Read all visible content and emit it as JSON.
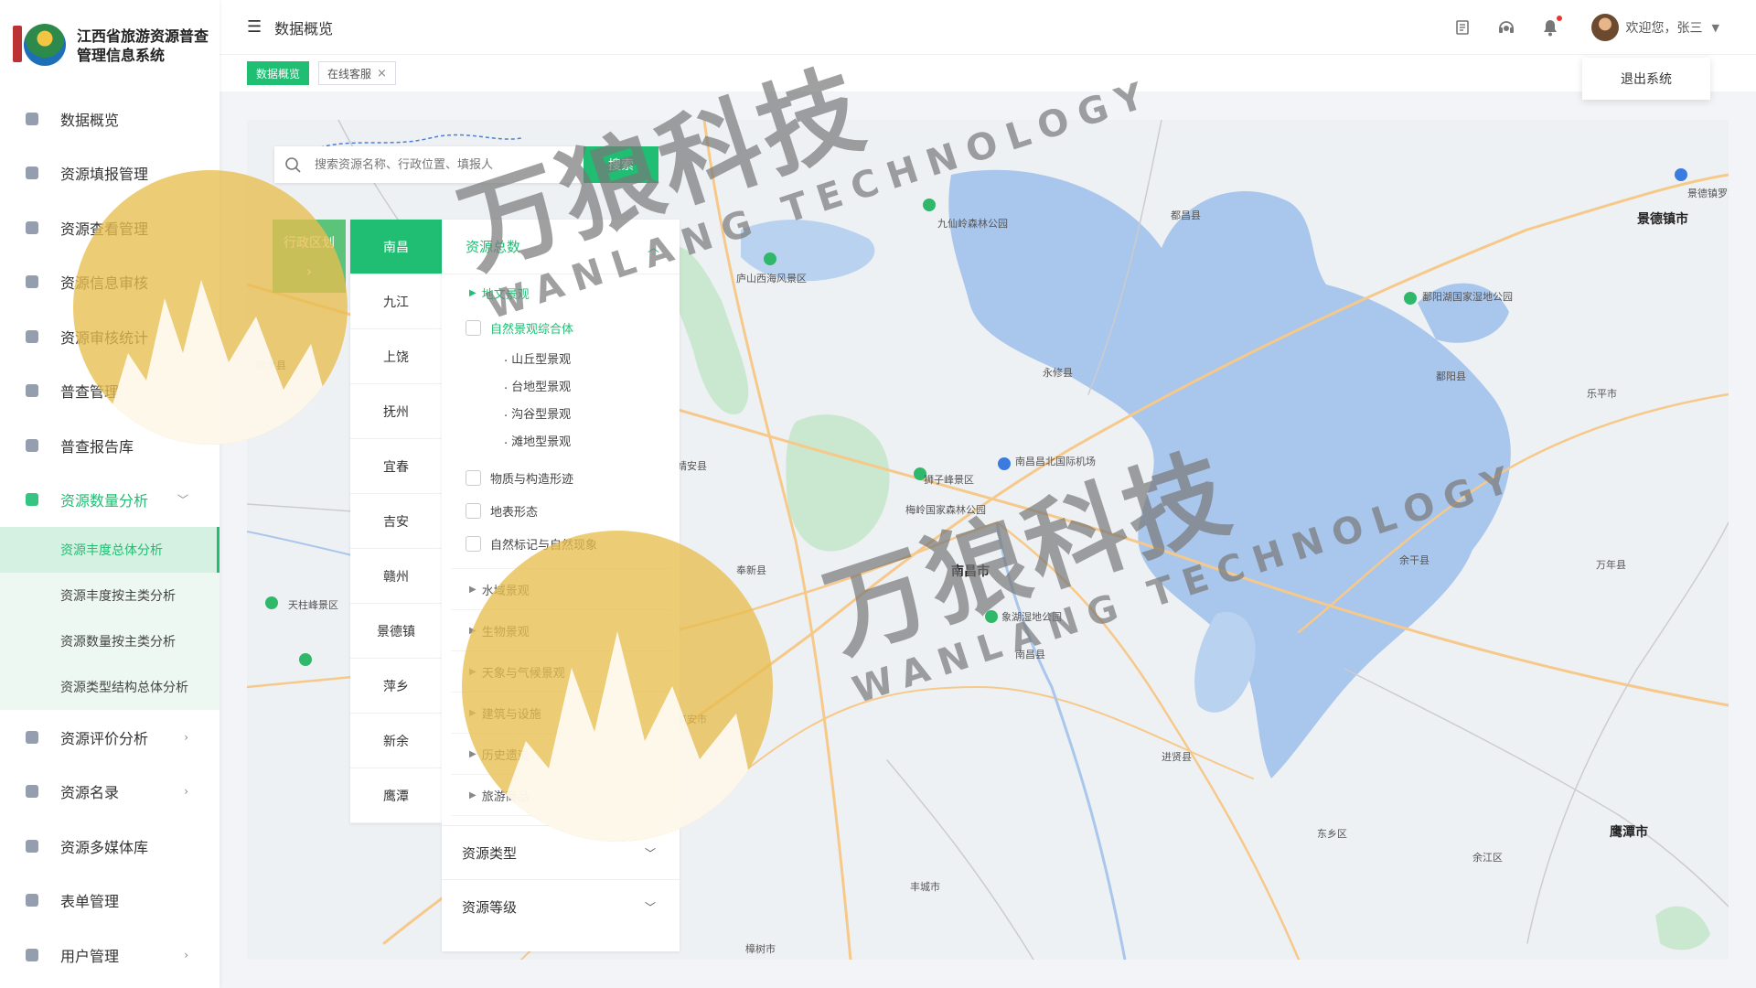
{
  "app": {
    "title_line1": "江西省旅游资源普查",
    "title_line2": "管理信息系统"
  },
  "sidebar": {
    "items": [
      {
        "label": "数据概览",
        "icon": "dashboard-icon"
      },
      {
        "label": "资源填报管理",
        "icon": "edit-doc-icon"
      },
      {
        "label": "资源查看管理",
        "icon": "search-doc-icon"
      },
      {
        "label": "资源信息审核",
        "icon": "user-check-icon"
      },
      {
        "label": "资源审核统计",
        "icon": "pie-chart-icon"
      },
      {
        "label": "普查管理",
        "icon": "user-gear-icon"
      },
      {
        "label": "普查报告库",
        "icon": "books-icon"
      },
      {
        "label": "资源数量分析",
        "icon": "layers-icon"
      },
      {
        "label": "资源评价分析",
        "icon": "badge-icon"
      },
      {
        "label": "资源名录",
        "icon": "catalog-icon"
      },
      {
        "label": "资源多媒体库",
        "icon": "video-icon"
      },
      {
        "label": "表单管理",
        "icon": "form-icon"
      },
      {
        "label": "用户管理",
        "icon": "users-icon"
      }
    ],
    "submenu": [
      {
        "label": "资源丰度总体分析"
      },
      {
        "label": "资源丰度按主类分析"
      },
      {
        "label": "资源数量按主类分析"
      },
      {
        "label": "资源类型结构总体分析"
      }
    ]
  },
  "header": {
    "breadcrumb": "数据概览",
    "welcome": "欢迎您，张三",
    "logout": "退出系统"
  },
  "tabs": [
    {
      "label": "数据概览"
    },
    {
      "label": "在线客服",
      "close": "×"
    }
  ],
  "search": {
    "placeholder": "搜索资源名称、行政位置、填报人",
    "button": "搜索"
  },
  "region": {
    "label": "行政区划",
    "arrow": "›"
  },
  "cities": [
    "南昌",
    "九江",
    "上饶",
    "抚州",
    "宜春",
    "吉安",
    "赣州",
    "景德镇",
    "萍乡",
    "新余",
    "鹰潭"
  ],
  "filter": {
    "title": "资源总数",
    "open_category": "地文景观",
    "checks": [
      "自然景观综合体",
      "物质与构造形迹",
      "地表形态",
      "自然标记与自然现象"
    ],
    "subitems": [
      "山丘型景观",
      "台地型景观",
      "沟谷型景观",
      "滩地型景观"
    ],
    "categories": [
      "水域景观",
      "生物景观",
      "天象与气候景观",
      "建筑与设施",
      "历史遗迹",
      "旅游商品"
    ],
    "sections": [
      "资源类型",
      "资源等级"
    ]
  },
  "map": {
    "labels": [
      {
        "text": "景德镇市",
        "cls": "city",
        "pos": 0
      },
      {
        "text": "都昌县",
        "cls": "",
        "pos": 1
      },
      {
        "text": "九仙岭森林公园",
        "cls": "",
        "pos": 2
      },
      {
        "text": "庐山西海风景区",
        "cls": "",
        "pos": 3
      },
      {
        "text": "南昌市",
        "cls": "city",
        "pos": 4
      },
      {
        "text": "鹰潭市",
        "cls": "city",
        "pos": 5
      },
      {
        "text": "永修县",
        "cls": "",
        "pos": 6
      },
      {
        "text": "靖安县",
        "cls": "",
        "pos": 7
      },
      {
        "text": "狮子峰景区",
        "cls": "",
        "pos": 8
      },
      {
        "text": "南昌昌北国际机场",
        "cls": "",
        "pos": 9
      },
      {
        "text": "鄱阳湖国家湿地公园",
        "cls": "",
        "pos": 10
      },
      {
        "text": "鄱阳县",
        "cls": "",
        "pos": 11
      },
      {
        "text": "乐平市",
        "cls": "",
        "pos": 12
      },
      {
        "text": "余干县",
        "cls": "",
        "pos": 13
      },
      {
        "text": "万年县",
        "cls": "",
        "pos": 14
      },
      {
        "text": "进贤县",
        "cls": "",
        "pos": 15
      },
      {
        "text": "东乡区",
        "cls": "",
        "pos": 16
      },
      {
        "text": "余江区",
        "cls": "",
        "pos": 17
      },
      {
        "text": "丰城市",
        "cls": "",
        "pos": 18
      },
      {
        "text": "高安市",
        "cls": "",
        "pos": 19
      },
      {
        "text": "奉新县",
        "cls": "",
        "pos": 20
      },
      {
        "text": "修水县",
        "cls": "",
        "pos": 21
      },
      {
        "text": "天柱峰景区",
        "cls": "",
        "pos": 22
      },
      {
        "text": "梅岭国家森林公园",
        "cls": "",
        "pos": 23
      },
      {
        "text": "南昌县",
        "cls": "",
        "pos": 24
      },
      {
        "text": "象湖湿地公园",
        "cls": "",
        "pos": 25
      },
      {
        "text": "景德镇罗家机场",
        "cls": "",
        "pos": 26
      },
      {
        "text": "樟树市",
        "cls": "",
        "pos": 27
      }
    ]
  },
  "watermark": {
    "cn": "万狼科技",
    "en": "WANLANG TECHNOLOGY"
  }
}
